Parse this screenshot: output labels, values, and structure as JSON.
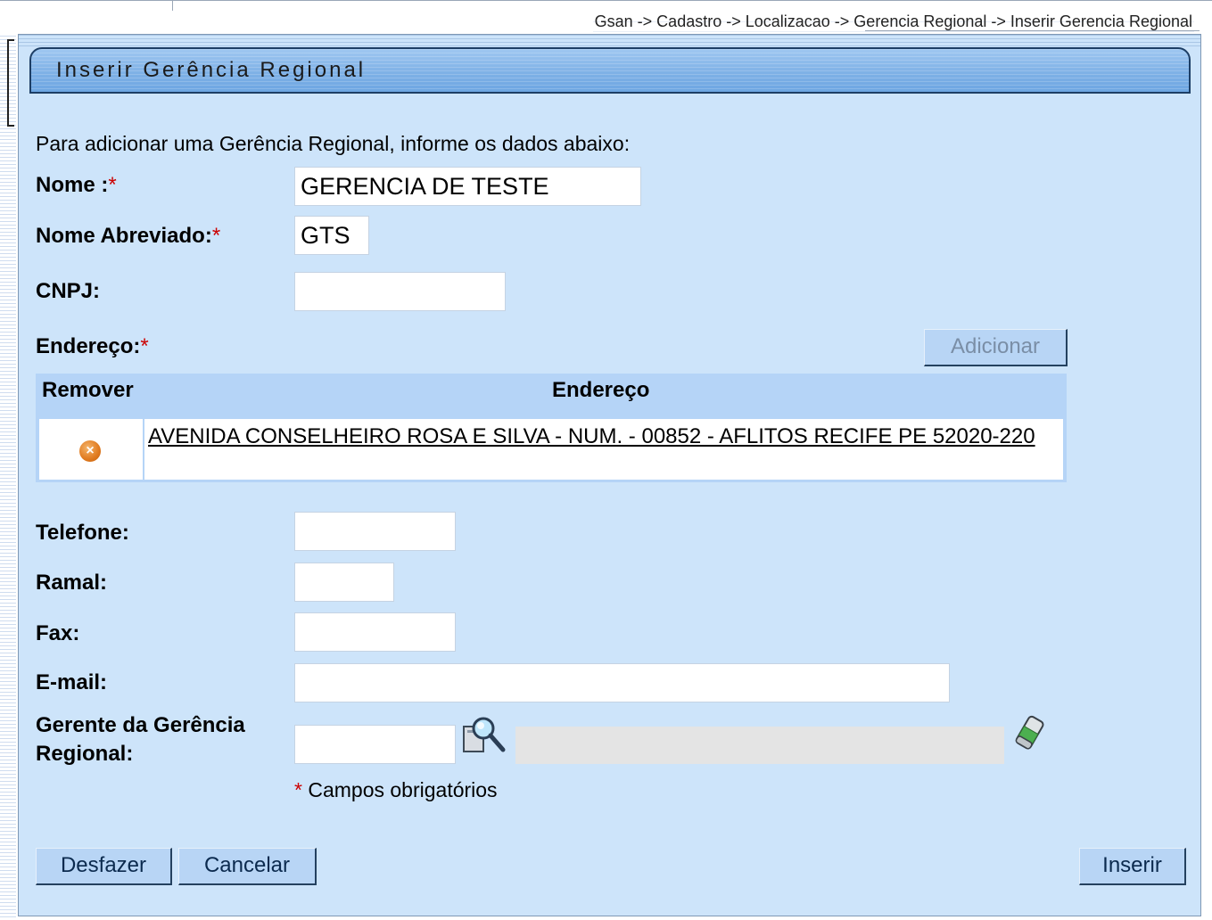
{
  "breadcrumb": "Gsan -> Cadastro -> Localizacao -> Gerencia Regional -> Inserir Gerencia Regional",
  "title": "Inserir Gerência Regional",
  "intro": "Para adicionar uma Gerência Regional, informe os dados abaixo:",
  "required_mark": "*",
  "fields": {
    "nome": {
      "label": "Nome :",
      "value": "GERENCIA DE TESTE"
    },
    "nome_abreviado": {
      "label": "Nome Abreviado:",
      "value": "GTS"
    },
    "cnpj": {
      "label": "CNPJ:",
      "value": ""
    },
    "endereco": {
      "label": "Endereço:"
    },
    "telefone": {
      "label": "Telefone:",
      "value": ""
    },
    "ramal": {
      "label": "Ramal:",
      "value": ""
    },
    "fax": {
      "label": "Fax:",
      "value": ""
    },
    "email": {
      "label": "E-mail:",
      "value": ""
    },
    "gerente": {
      "label_line1": "Gerente da Gerência",
      "label_line2": "Regional:",
      "value": "",
      "name_value": ""
    }
  },
  "buttons": {
    "adicionar": "Adicionar",
    "desfazer": "Desfazer",
    "cancelar": "Cancelar",
    "inserir": "Inserir"
  },
  "address_table": {
    "headers": [
      "Remover",
      "Endereço"
    ],
    "rows": [
      {
        "remove_icon": "remove-icon",
        "address": "AVENIDA CONSELHEIRO ROSA E SILVA - NUM. - 00852 - AFLITOS RECIFE PE 52020-220"
      }
    ]
  },
  "footnote": "Campos obrigatórios",
  "icons": {
    "search": "magnifier-search-icon",
    "clear": "eraser-icon",
    "remove": "remove-icon"
  },
  "colors": {
    "panel_bg": "#cde4fa",
    "title_bar": "#7fb1e6",
    "button_bg": "#b8d5f5",
    "required": "#cc0000",
    "table_header": "#b5d4f7"
  }
}
